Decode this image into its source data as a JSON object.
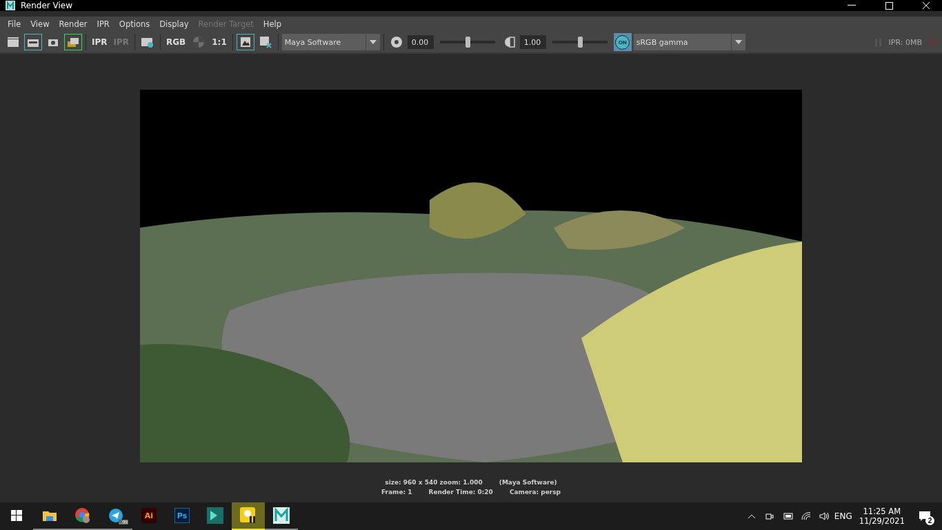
{
  "window": {
    "title": "Render View"
  },
  "menu": [
    {
      "label": "File",
      "disabled": false
    },
    {
      "label": "View",
      "disabled": false
    },
    {
      "label": "Render",
      "disabled": false
    },
    {
      "label": "IPR",
      "disabled": false
    },
    {
      "label": "Options",
      "disabled": false
    },
    {
      "label": "Display",
      "disabled": false
    },
    {
      "label": "Render Target",
      "disabled": true
    },
    {
      "label": "Help",
      "disabled": false
    }
  ],
  "toolbar": [
    {
      "kind": "clapboard",
      "toggled": false,
      "selected": false,
      "disabled": false
    },
    {
      "kind": "clapboard-region",
      "toggled": true,
      "selected": false,
      "disabled": false
    },
    {
      "kind": "camera",
      "toggled": false,
      "selected": false,
      "disabled": false
    },
    {
      "kind": "snapshot",
      "toggled": false,
      "selected": true,
      "disabled": false
    },
    {
      "kind": "separator"
    },
    {
      "kind": "ipr",
      "label": "IPR",
      "toggled": false,
      "selected": false,
      "disabled": false
    },
    {
      "kind": "refresh",
      "label": "IPR",
      "toggled": false,
      "selected": false,
      "disabled": true
    },
    {
      "kind": "separator"
    },
    {
      "kind": "settings",
      "toggled": false,
      "selected": false,
      "disabled": false
    },
    {
      "kind": "separator"
    },
    {
      "kind": "text",
      "label": "RGB",
      "toggled": false,
      "selected": false,
      "disabled": false
    },
    {
      "kind": "checker",
      "toggled": false,
      "selected": false,
      "disabled": true
    },
    {
      "kind": "text",
      "label": "1:1",
      "toggled": false,
      "selected": false,
      "disabled": false
    },
    {
      "kind": "separator"
    },
    {
      "kind": "image",
      "toggled": true,
      "selected": false,
      "disabled": false
    },
    {
      "kind": "image-remove",
      "toggled": false,
      "selected": false,
      "disabled": false
    },
    {
      "kind": "separator"
    }
  ],
  "renderer": {
    "value": "Maya Software"
  },
  "exposure": {
    "value": "0.00",
    "level": 0.5
  },
  "gamma": {
    "value": "1.00",
    "level": 0.5
  },
  "color_management": {
    "label": "ON",
    "on": true
  },
  "color_space": {
    "value": "sRGB gamma"
  },
  "ipr_memory": "IPR: 0MB",
  "status": {
    "line_1": [
      "size: 960 x 540 zoom: 1.000",
      "(Maya Software)"
    ],
    "line_2": [
      "Frame: 1",
      "Render Time: 0:20",
      "Camera: persp"
    ]
  },
  "taskbar": {
    "apps": [
      {
        "kind": "folder",
        "running": true,
        "active": false
      },
      {
        "kind": "chrome",
        "running": true,
        "active": false
      },
      {
        "kind": "telegram",
        "badge": "..99",
        "running": true,
        "active": false
      },
      {
        "kind": "ai",
        "label": "Ai",
        "running": false,
        "active": false
      },
      {
        "kind": "ps",
        "label": "Ps",
        "running": false,
        "active": false
      },
      {
        "kind": "max",
        "running": false,
        "active": false
      },
      {
        "kind": "player",
        "running": true,
        "active": true
      },
      {
        "kind": "maya",
        "running": true,
        "active": false
      }
    ],
    "language": "ENG",
    "time": "11:25 AM",
    "date": "11/29/2021",
    "notifications": "2"
  }
}
